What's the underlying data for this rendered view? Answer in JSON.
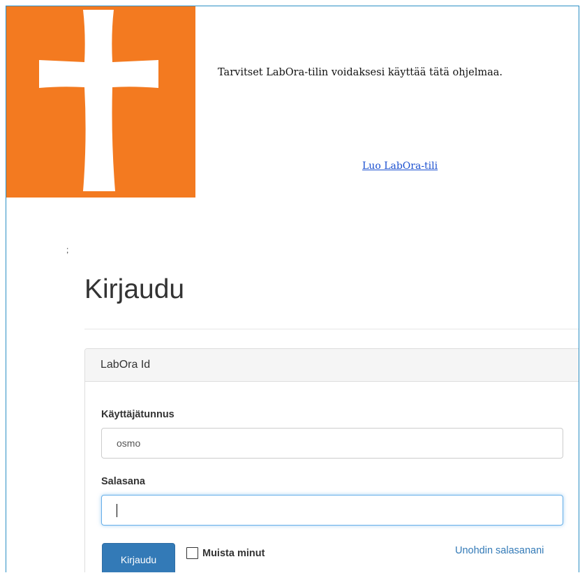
{
  "banner": {
    "intro_text": "Tarvitset LabOra-tilin voidaksesi käyttää tätä ohjelmaa.",
    "create_account_link": "Luo LabOra-tili",
    "logo_icon": "cross-icon",
    "logo_color": "#f37a20"
  },
  "stray_text": ";",
  "page": {
    "title": "Kirjaudu"
  },
  "panel": {
    "heading": "LabOra Id",
    "username_label": "Käyttäjätunnus",
    "username_value": "osmo",
    "password_label": "Salasana",
    "password_value": "",
    "login_button": "Kirjaudu",
    "remember_label": "Muista minut",
    "remember_checked": false,
    "forgot_link": "Unohdin salasanani"
  },
  "colors": {
    "frame_border": "#2b8fc4",
    "primary_button": "#337ab7",
    "link": "#337ab7",
    "focus_ring": "#66afe9"
  }
}
